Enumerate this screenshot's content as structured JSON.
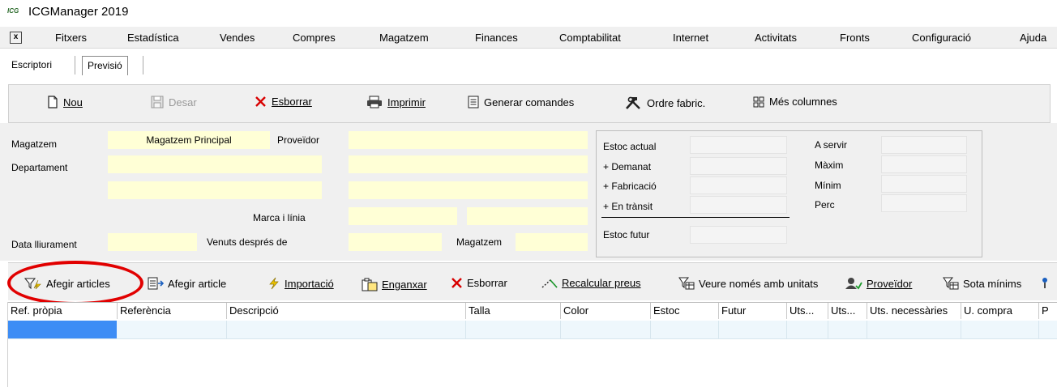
{
  "app": {
    "title": "ICGManager 2019",
    "logo_text": "ICG"
  },
  "menu": {
    "close_label": "x",
    "items": [
      "Fitxers",
      "Estadística",
      "Vendes",
      "Compres",
      "Magatzem",
      "Finances",
      "Comptabilitat",
      "Internet",
      "Activitats",
      "Fronts",
      "Configuració",
      "Ajuda"
    ]
  },
  "tabs": [
    {
      "label": "Escriptori",
      "active": false
    },
    {
      "label": "Previsió",
      "active": true
    }
  ],
  "toolbar": {
    "new_label": "Nou",
    "save_label": "Desar",
    "delete_label": "Esborrar",
    "print_label": "Imprimir",
    "generate_orders_label": "Generar comandes",
    "manufacturing_order_label": "Ordre fabric.",
    "more_columns_label": "Més columnes"
  },
  "form": {
    "warehouse_label": "Magatzem",
    "warehouse_value": "Magatzem Principal",
    "supplier_label": "Proveïdor",
    "department_label": "Departament",
    "brand_line_label": "Marca i línia",
    "delivery_date_label": "Data lliurament",
    "sold_after_label": "Venuts després de",
    "warehouse2_label": "Magatzem"
  },
  "stock": {
    "current_label": "Estoc actual",
    "ordered_label": "+ Demanat",
    "manufacturing_label": "+ Fabricació",
    "in_transit_label": "+ En trànsit",
    "future_label": "Estoc futur",
    "to_serve_label": "A servir",
    "max_label": "Màxim",
    "min_label": "Mínim",
    "perc_label": "Perc"
  },
  "toolbar2": {
    "add_articles_label": "Afegir articles",
    "add_article_label": "Afegir article",
    "import_label": "Importació",
    "paste_label": "Enganxar",
    "delete_label": "Esborrar",
    "recalc_prices_label": "Recalcular preus",
    "only_units_label": "Veure només amb unitats",
    "supplier_label": "Proveïdor",
    "below_min_label": "Sota mínims"
  },
  "grid": {
    "columns": [
      "Ref. pròpia",
      "Referència",
      "Descripció",
      "Talla",
      "Color",
      "Estoc",
      "Futur",
      "Uts...",
      "Uts...",
      "Uts. necessàries",
      "U. compra",
      "P"
    ]
  },
  "colors": {
    "field_yellow": "#ffffd6",
    "selection_blue": "#3d8df5",
    "highlight_red": "#e10000",
    "panel_gray": "#f0f0f0"
  }
}
